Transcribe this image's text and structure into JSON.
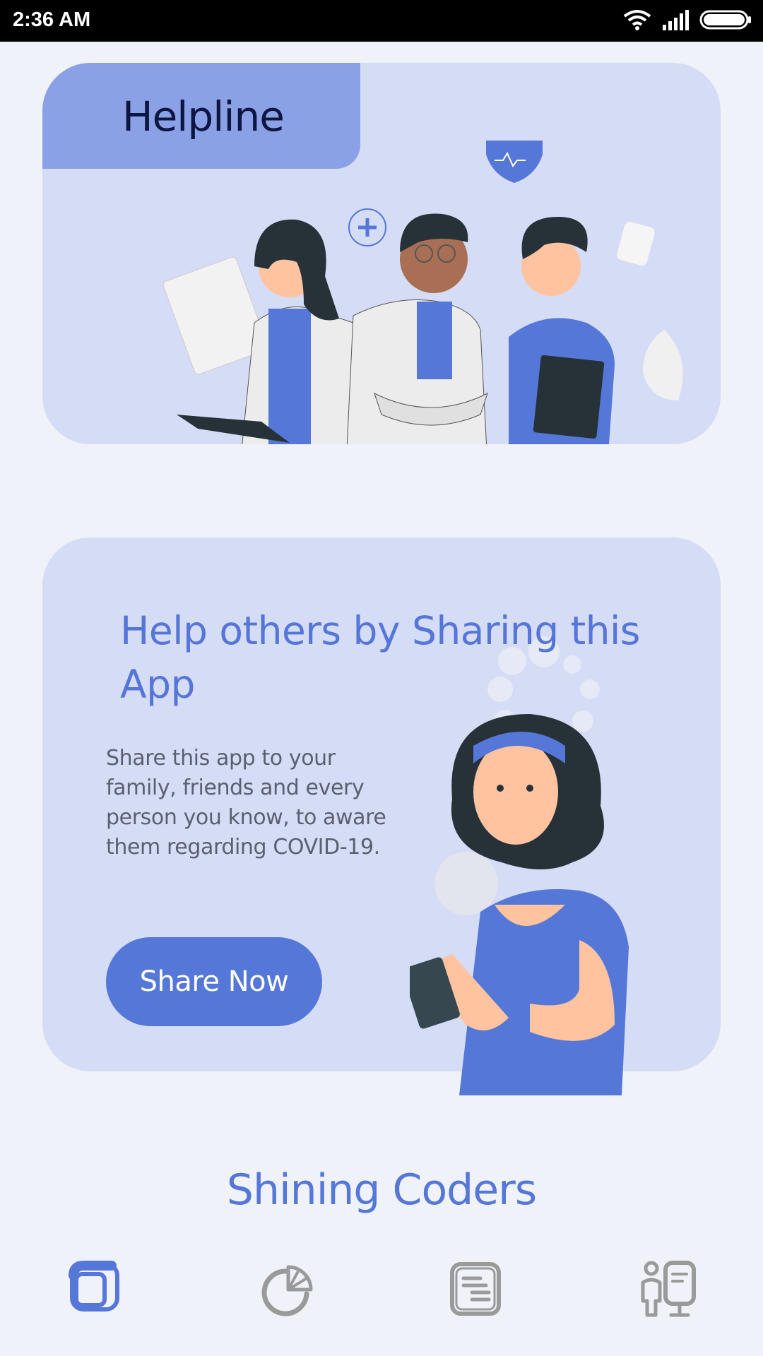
{
  "status_bar": {
    "time": "2:36 AM",
    "icons": [
      "wifi-icon",
      "signal-icon",
      "battery-icon"
    ]
  },
  "helpline_card": {
    "title": "Helpline",
    "illustration": "doctors-illustration"
  },
  "share_card": {
    "title": "Help others by Sharing this App",
    "description": "Share this app to your family, friends and every person you know, to aware them regarding COVID-19.",
    "button_label": "Share Now",
    "illustration": "woman-with-phone-illustration"
  },
  "footer": {
    "brand": "Shining Coders"
  },
  "bottom_nav": {
    "items": [
      {
        "icon": "home-square-icon",
        "active": true
      },
      {
        "icon": "pie-chart-icon",
        "active": false
      },
      {
        "icon": "news-list-icon",
        "active": false
      },
      {
        "icon": "advice-icon",
        "active": false
      }
    ]
  },
  "colors": {
    "background": "#f0f2fa",
    "card": "#d5dcf5",
    "tab": "#8ba1e6",
    "accent": "#5577d8",
    "inactive_icon": "#9a9a9a"
  }
}
